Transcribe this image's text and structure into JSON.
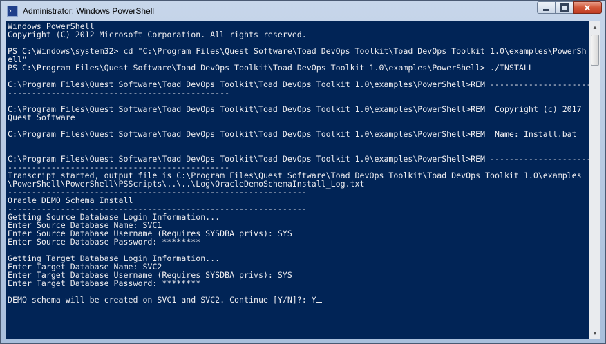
{
  "window": {
    "title": "Administrator: Windows PowerShell",
    "icon": "powershell-icon",
    "icon_glyph": "›_",
    "buttons": {
      "minimize": "minimize-button",
      "maximize": "maximize-button",
      "close": "close-button",
      "close_glyph": "✕"
    }
  },
  "console": {
    "background": "#012456",
    "foreground": "#eeedf0",
    "lines": [
      "Windows PowerShell",
      "Copyright (C) 2012 Microsoft Corporation. All rights reserved.",
      "",
      "PS C:\\Windows\\system32> cd \"C:\\Program Files\\Quest Software\\Toad DevOps Toolkit\\Toad DevOps Toolkit 1.0\\examples\\PowerSh",
      "ell\"",
      "PS C:\\Program Files\\Quest Software\\Toad DevOps Toolkit\\Toad DevOps Toolkit 1.0\\examples\\PowerShell> ./INSTALL",
      "",
      "C:\\Program Files\\Quest Software\\Toad DevOps Toolkit\\Toad DevOps Toolkit 1.0\\examples\\PowerShell>REM ---------------------",
      "----------------------------------------------",
      "",
      "C:\\Program Files\\Quest Software\\Toad DevOps Toolkit\\Toad DevOps Toolkit 1.0\\examples\\PowerShell>REM  Copyright (c) 2017",
      "Quest Software",
      "",
      "C:\\Program Files\\Quest Software\\Toad DevOps Toolkit\\Toad DevOps Toolkit 1.0\\examples\\PowerShell>REM  Name: Install.bat",
      "",
      "",
      "C:\\Program Files\\Quest Software\\Toad DevOps Toolkit\\Toad DevOps Toolkit 1.0\\examples\\PowerShell>REM ---------------------",
      "----------------------------------------------",
      "Transcript started, output file is C:\\Program Files\\Quest Software\\Toad DevOps Toolkit\\Toad DevOps Toolkit 1.0\\examples",
      "\\PowerShell\\PowerShell\\PSScripts\\..\\..\\Log\\OracleDemoSchemaInstall_Log.txt",
      "--------------------------------------------------------------",
      "Oracle DEMO Schema Install",
      "--------------------------------------------------------------",
      "Getting Source Database Login Information...",
      "Enter Source Database Name: SVC1",
      "Enter Source Database Username (Requires SYSDBA privs): SYS",
      "Enter Source Database Password: ********",
      "",
      "Getting Target Database Login Information...",
      "Enter Target Database Name: SVC2",
      "Enter Target Database Username (Requires SYSDBA privs): SYS",
      "Enter Target Database Password: ********",
      "",
      "DEMO schema will be created on SVC1 and SVC2. Continue [Y/N]?: Y"
    ]
  }
}
